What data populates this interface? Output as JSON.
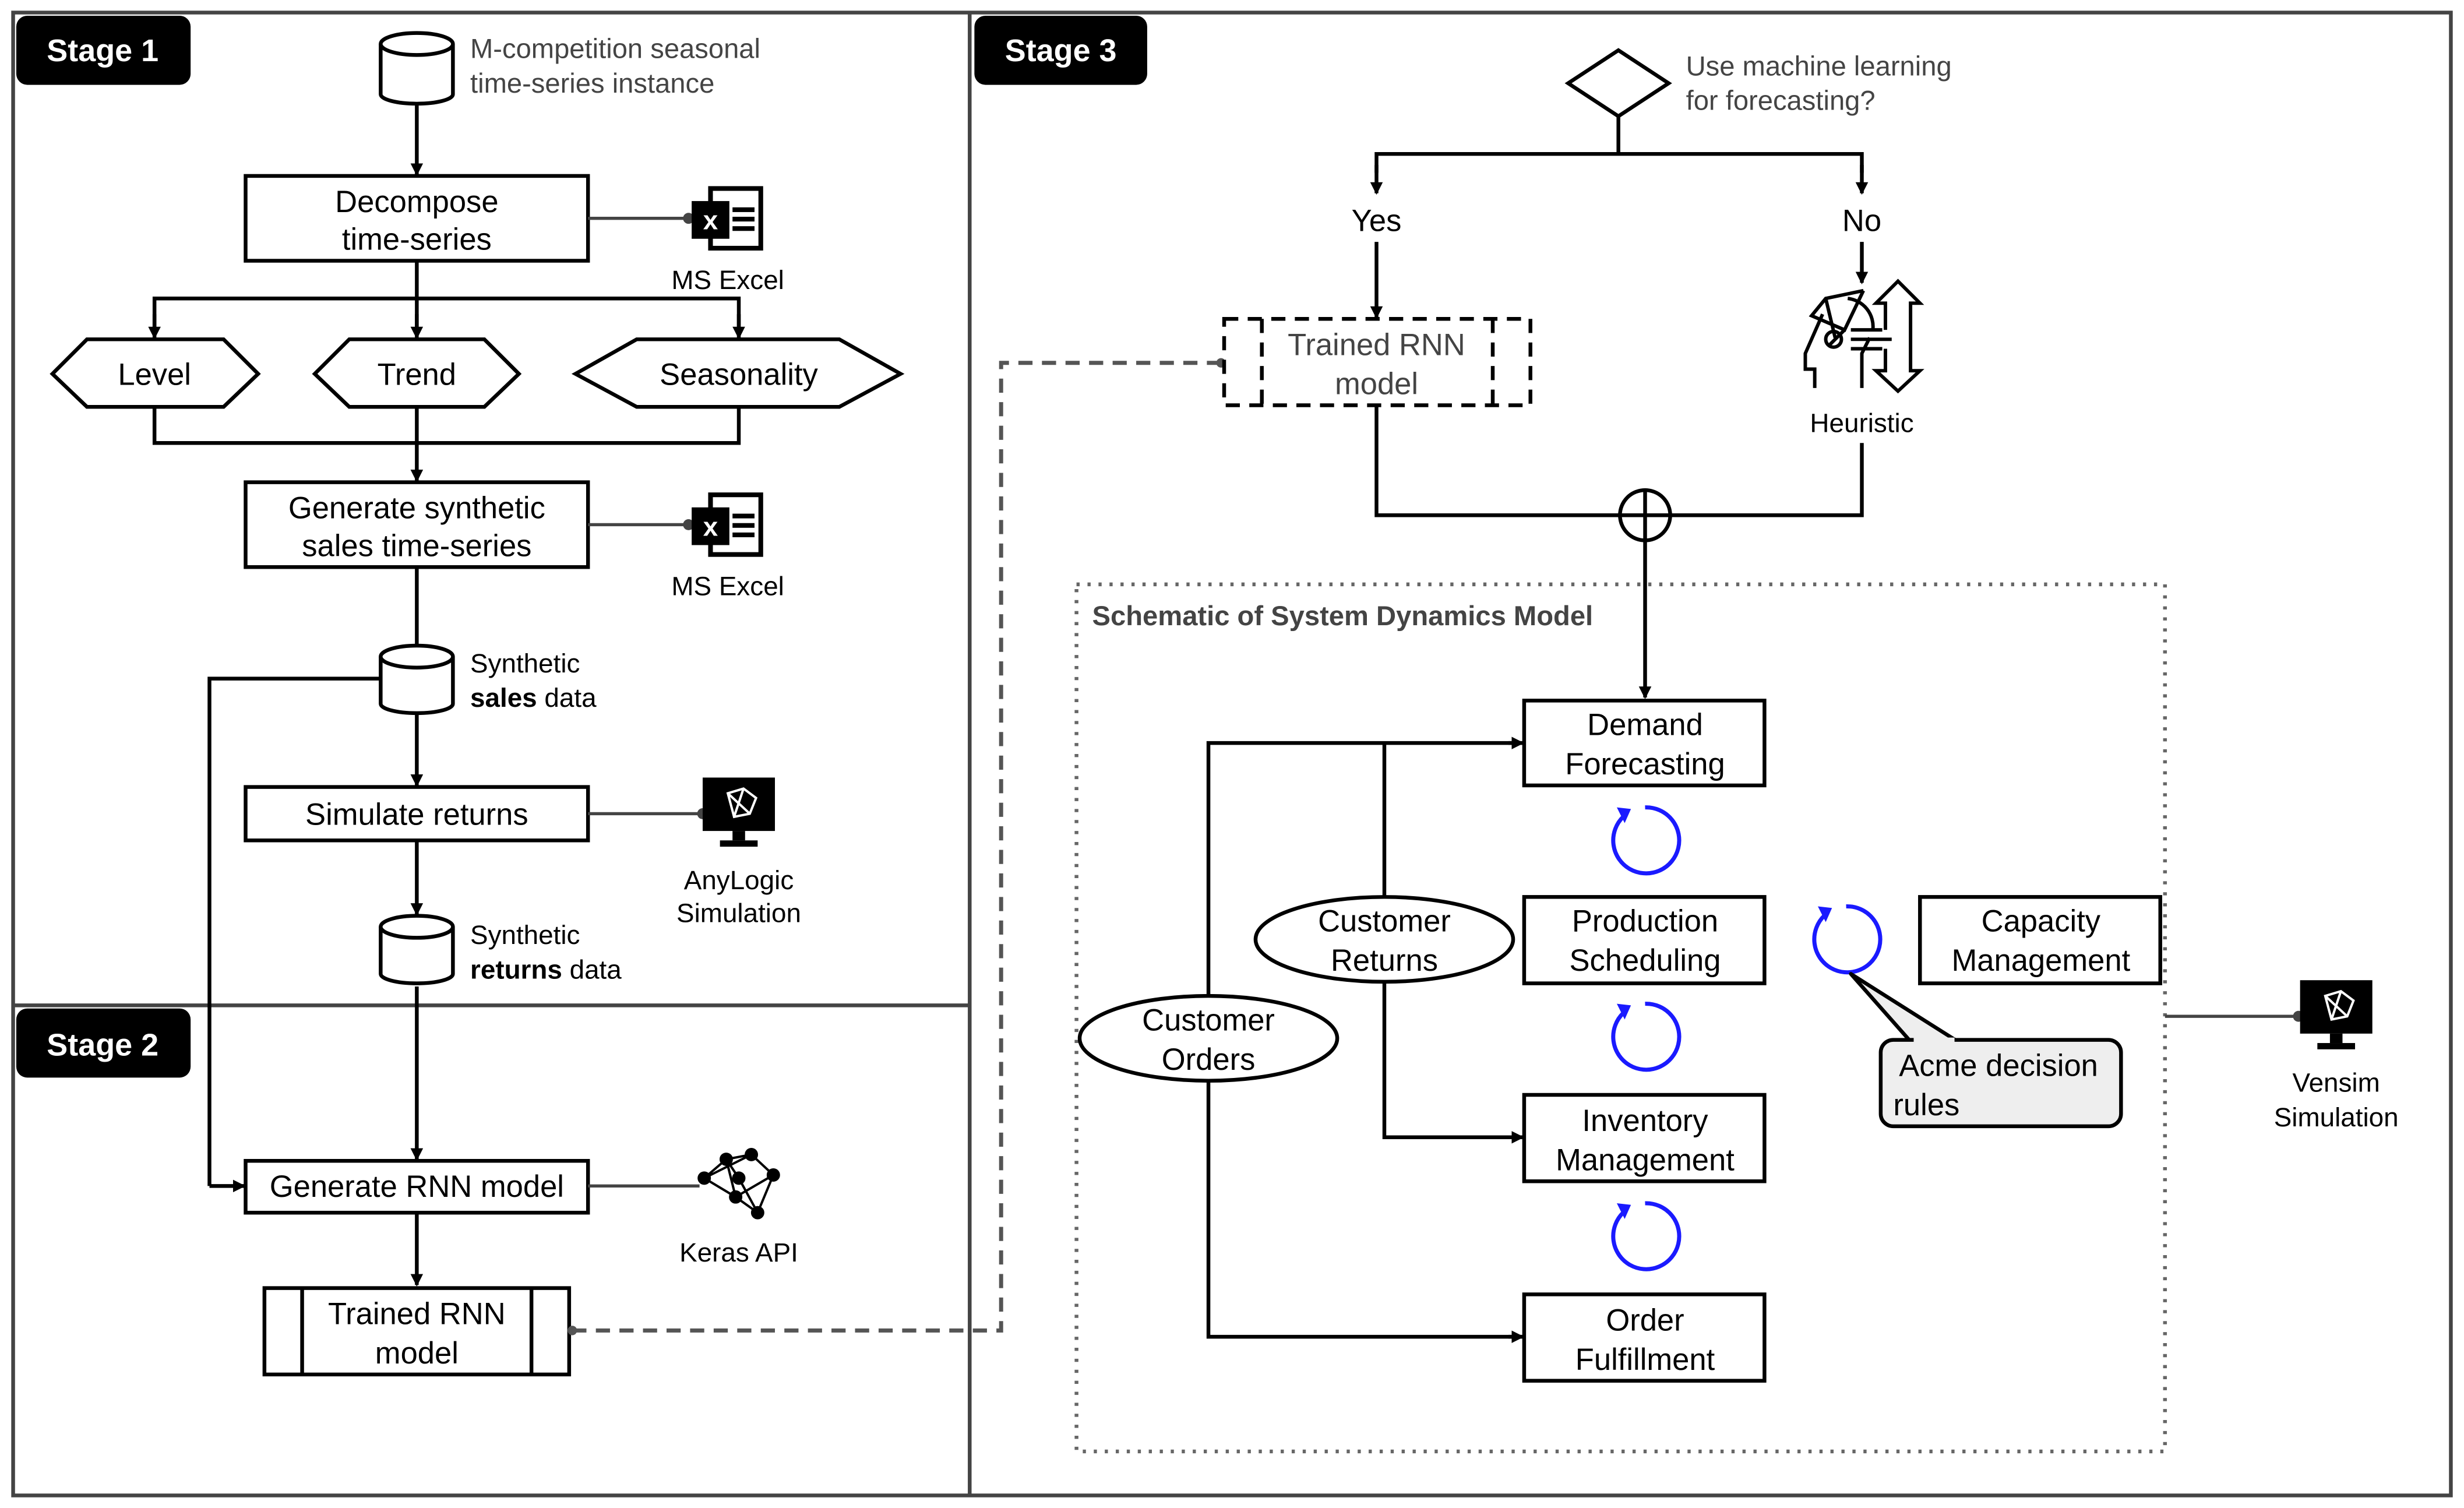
{
  "stages": {
    "stage1": "Stage 1",
    "stage2": "Stage 2",
    "stage3": "Stage 3"
  },
  "stage1": {
    "source_line1": "M-competition seasonal",
    "source_line2": "time-series instance",
    "decompose_line1": "Decompose",
    "decompose_line2": "time-series",
    "excel_label": "MS Excel",
    "level": "Level",
    "trend": "Trend",
    "seasonality": "Seasonality",
    "generate_line1": "Generate synthetic",
    "generate_line2": "sales time-series",
    "excel_label2": "MS Excel",
    "sales_line1": "Synthetic",
    "sales_bold": "sales",
    "sales_rest": " data",
    "simulate": "Simulate returns",
    "anylogic_line1": "AnyLogic",
    "anylogic_line2": "Simulation",
    "returns_line1": "Synthetic",
    "returns_bold": "returns",
    "returns_rest": " data"
  },
  "stage2": {
    "generate_rnn": "Generate RNN model",
    "keras_label": "Keras API",
    "trained_line1": "Trained RNN",
    "trained_line2": "model"
  },
  "stage3": {
    "question_line1": "Use machine learning",
    "question_line2": "for forecasting?",
    "yes": "Yes",
    "no": "No",
    "trained_line1": "Trained RNN",
    "trained_line2": "model",
    "heuristic": "Heuristic",
    "sd_title": "Schematic of System Dynamics Model",
    "demand_line1": "Demand",
    "demand_line2": "Forecasting",
    "production_line1": "Production",
    "production_line2": "Scheduling",
    "inventory_line1": "Inventory",
    "inventory_line2": "Management",
    "order_line1": "Order",
    "order_line2": "Fulfillment",
    "capacity_line1": "Capacity",
    "capacity_line2": "Management",
    "returns_line1": "Customer",
    "returns_line2": "Returns",
    "orders_line1": "Customer",
    "orders_line2": "Orders",
    "acme_line1": "Acme decision",
    "acme_line2": "rules",
    "vensim_line1": "Vensim",
    "vensim_line2": "Simulation"
  },
  "colors": {
    "loop": "#1a1aff",
    "stage_badge": "#000000",
    "callout_fill": "#eeeeee"
  }
}
